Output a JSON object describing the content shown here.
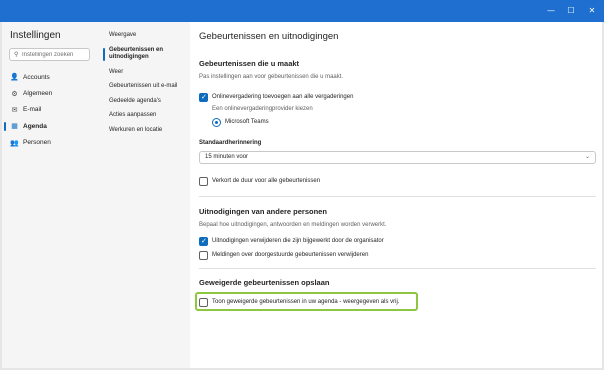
{
  "window": {
    "buttons": {
      "minimize": "—",
      "maximize": "☐",
      "close": "✕"
    }
  },
  "sidebar": {
    "title": "Instellingen",
    "search_placeholder": "Instellingen zoeken",
    "items": [
      {
        "label": "Accounts",
        "icon": "person-icon",
        "glyph": "👤"
      },
      {
        "label": "Algemeen",
        "icon": "gear-icon",
        "glyph": "⚙"
      },
      {
        "label": "E-mail",
        "icon": "mail-icon",
        "glyph": "✉"
      },
      {
        "label": "Agenda",
        "icon": "calendar-icon",
        "glyph": "▦",
        "active": true
      },
      {
        "label": "Personen",
        "icon": "people-icon",
        "glyph": "👥"
      }
    ]
  },
  "subnav": {
    "items": [
      {
        "label": "Weergave"
      },
      {
        "label": "Gebeurtenissen en uitnodigingen",
        "active": true
      },
      {
        "label": "Weer"
      },
      {
        "label": "Gebeurtenissen uit e-mail"
      },
      {
        "label": "Gedeelde agenda's"
      },
      {
        "label": "Acties aanpassen"
      },
      {
        "label": "Werkuren en locatie"
      }
    ]
  },
  "main": {
    "title": "Gebeurtenissen en uitnodigingen",
    "section1": {
      "title": "Gebeurtenissen die u maakt",
      "desc": "Pas instellingen aan voor gebeurtenissen die u maakt.",
      "online_meeting_label": "Onlinevergadering toevoegen aan alle vergaderingen",
      "online_meeting_checked": true,
      "provider_label": "Een onlinevergaderingprovider kiezen",
      "provider_option": "Microsoft Teams",
      "reminder_label": "Standaardherinnering",
      "reminder_value": "15 minuten voor",
      "shorten_label": "Verkort de duur voor alle gebeurtenissen",
      "shorten_checked": false
    },
    "section2": {
      "title": "Uitnodigingen van andere personen",
      "desc": "Bepaal hoe uitnodigingen, antwoorden en meldingen worden verwerkt.",
      "delete_updated_label": "Uitnodigingen verwijderen die zijn bijgewerkt door de organisator",
      "delete_updated_checked": true,
      "delete_forwarded_label": "Meldingen over doorgestuurde gebeurtenissen verwijderen",
      "delete_forwarded_checked": false
    },
    "section3": {
      "title": "Geweigerde gebeurtenissen opslaan",
      "show_declined_label": "Toon geweigerde gebeurtenissen in uw agenda - weergegeven als vrij.",
      "show_declined_checked": false
    }
  },
  "colors": {
    "titlebar": "#1f6fd0",
    "accent": "#0f6cbd",
    "highlight": "#8dc63f"
  }
}
